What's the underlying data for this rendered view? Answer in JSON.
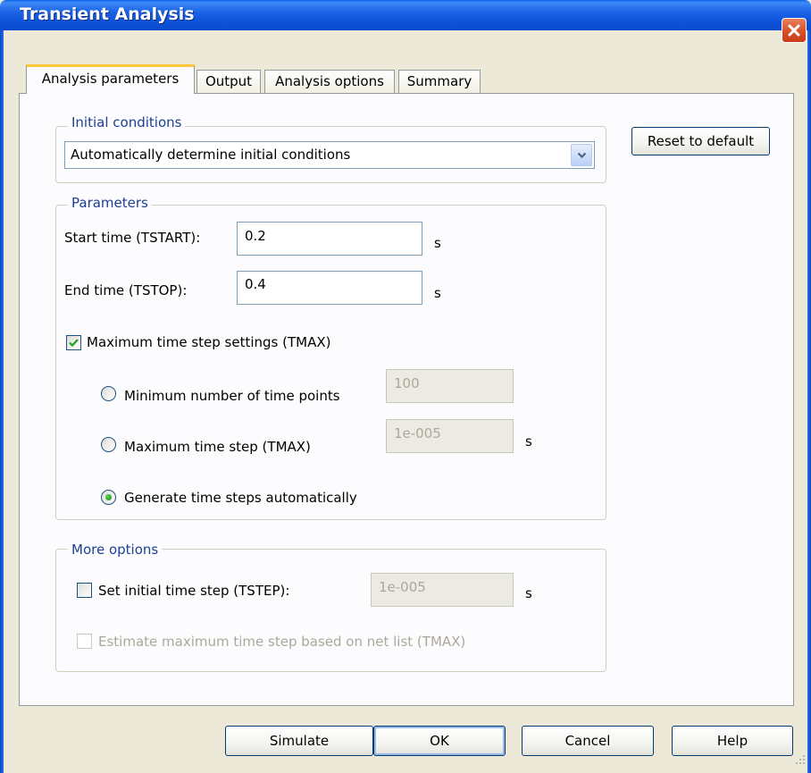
{
  "window": {
    "title": "Transient Analysis"
  },
  "tabs": [
    {
      "label": "Analysis parameters",
      "active": true
    },
    {
      "label": "Output",
      "active": false
    },
    {
      "label": "Analysis options",
      "active": false
    },
    {
      "label": "Summary",
      "active": false
    }
  ],
  "initial_conditions": {
    "group_label": "Initial conditions",
    "selected": "Automatically determine initial conditions"
  },
  "reset_button": "Reset to default",
  "parameters": {
    "group_label": "Parameters",
    "start_label": "Start time (TSTART):",
    "start_value": "0.2",
    "start_unit": "s",
    "end_label": "End time (TSTOP):",
    "end_value": "0.4",
    "end_unit": "s",
    "tmax_label": "Maximum time step settings (TMAX)",
    "tmax_checked": true,
    "radio_min_points_label": "Minimum number of time points",
    "radio_min_points_value": "100",
    "radio_max_step_label": "Maximum time step (TMAX)",
    "radio_max_step_value": "1e-005",
    "radio_max_step_unit": "s",
    "radio_auto_label": "Generate time steps automatically",
    "selected_radio": "auto"
  },
  "more_options": {
    "group_label": "More options",
    "tstep_label": "Set initial time step (TSTEP):",
    "tstep_checked": false,
    "tstep_value": "1e-005",
    "tstep_unit": "s",
    "estimate_label": "Estimate maximum time step based on net list (TMAX)",
    "estimate_checked": false
  },
  "buttons": {
    "simulate": "Simulate",
    "ok": "OK",
    "cancel": "Cancel",
    "help": "Help"
  },
  "colors": {
    "titlebar": "#0c4fd6",
    "group_label": "#1c3f94",
    "tab_highlight": "#ffc83c",
    "close_button": "#d9532b"
  }
}
